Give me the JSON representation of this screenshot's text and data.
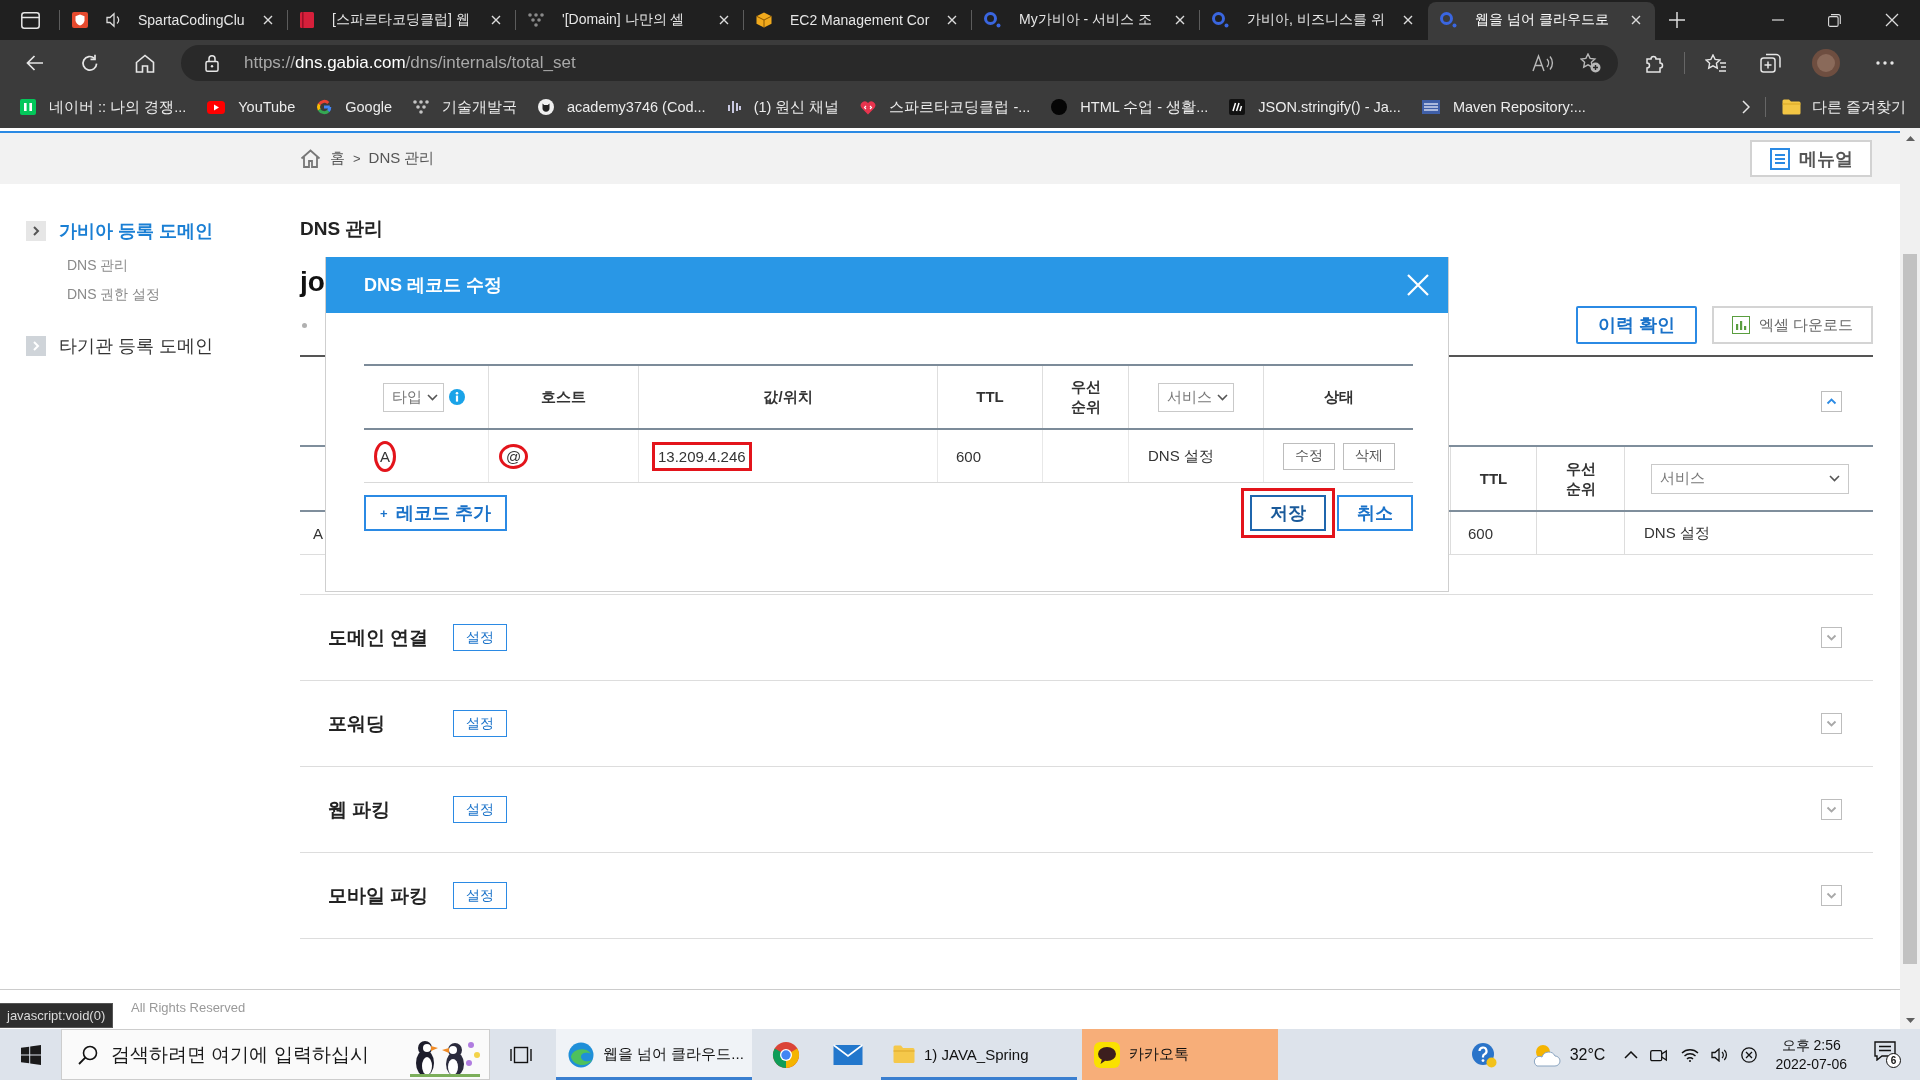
{
  "browser": {
    "tabs": [
      {
        "title": "SpartaCodingClu",
        "kind": "shield",
        "audio": true,
        "selected": false
      },
      {
        "title": "[스파르타코딩클럽] 웹",
        "kind": "book",
        "audio": false,
        "selected": false
      },
      {
        "title": "'[Domain] 나만의 셀",
        "kind": "dots",
        "audio": false,
        "selected": false
      },
      {
        "title": "EC2 Management Cor",
        "kind": "cube",
        "audio": false,
        "selected": false
      },
      {
        "title": "My가비아 - 서비스 조",
        "kind": "gabia",
        "audio": false,
        "selected": false
      },
      {
        "title": "가비아, 비즈니스를 위",
        "kind": "gabia",
        "audio": false,
        "selected": false
      },
      {
        "title": "웹을 넘어 클라우드로",
        "kind": "gabia",
        "audio": false,
        "selected": true
      }
    ],
    "address": {
      "scheme": "https://",
      "host": "dns.gabia.com",
      "path": "/dns/internals/total_set"
    },
    "bookmarks": [
      {
        "label": "네이버 :: 나의 경쟁...",
        "kind": "naver"
      },
      {
        "label": "YouTube",
        "kind": "youtube"
      },
      {
        "label": "Google",
        "kind": "google"
      },
      {
        "label": "기술개발국",
        "kind": "dots"
      },
      {
        "label": "academy3746 (Cod...",
        "kind": "github"
      },
      {
        "label": "(1) 원신 채널",
        "kind": "bars"
      },
      {
        "label": "스파르타코딩클럽 -...",
        "kind": "heart"
      },
      {
        "label": "HTML 수업 - 생활...",
        "kind": "circle"
      },
      {
        "label": "JSON.stringify() - Ja...",
        "kind": "m"
      },
      {
        "label": "Maven Repository:...",
        "kind": "maven"
      }
    ],
    "other_favorites": "다른 즐겨찾기"
  },
  "page": {
    "breadcrumb": {
      "home": "홈",
      "separator": ">",
      "current": "DNS 관리"
    },
    "manual_button": "메뉴얼",
    "sidebar": [
      {
        "label": "가비아 등록 도메인",
        "selected": true,
        "children": [
          {
            "label": "DNS 관리"
          },
          {
            "label": "DNS 권한 설정"
          }
        ]
      },
      {
        "label": "타기관 등록 도메인",
        "selected": false
      }
    ],
    "title": "DNS 관리",
    "domain": "jo",
    "history_button": "이력 확인",
    "excel_button": "엑셀 다운로드",
    "records_panel": {
      "expanded": true,
      "columns": [
        {
          "label": "TTL",
          "kind": "text"
        },
        {
          "label": "우선 순위",
          "kind": "text"
        },
        {
          "label": "서비스",
          "kind": "select"
        }
      ],
      "rows": [
        {
          "type": "A",
          "ttl": "600",
          "service": "DNS 설정"
        }
      ]
    },
    "sections": [
      {
        "title": "도메인 연결",
        "button": "설정",
        "expanded": false
      },
      {
        "title": "포워딩",
        "button": "설정",
        "expanded": false
      },
      {
        "title": "웹 파킹",
        "button": "설정",
        "expanded": false
      },
      {
        "title": "모바일 파킹",
        "button": "설정",
        "expanded": false
      }
    ],
    "footer": "All Rights Reserved",
    "status_link": "javascript:void(0)"
  },
  "modal": {
    "title": "DNS 레코드 수정",
    "columns": [
      {
        "label": "타입",
        "kind": "select",
        "help": true
      },
      {
        "label": "호스트",
        "kind": "text",
        "help": false
      },
      {
        "label": "값/위치",
        "kind": "text",
        "help": false
      },
      {
        "label": "TTL",
        "kind": "text",
        "help": false
      },
      {
        "label": "우선 순위",
        "kind": "text",
        "help": false
      },
      {
        "label": "서비스",
        "kind": "select",
        "help": false
      },
      {
        "label": "상태",
        "kind": "text",
        "help": false
      }
    ],
    "records": [
      {
        "type": "A",
        "type_marked": true,
        "host": "@",
        "host_marked": true,
        "value": "13.209.4.246",
        "value_marked": true,
        "ttl": "600",
        "service": "DNS 설정",
        "actions": [
          "수정",
          "삭제"
        ]
      }
    ],
    "add_button": {
      "prefix": "+",
      "label": "레코드 추가"
    },
    "save_button": {
      "label": "저장",
      "marked": true
    },
    "cancel_button": "취소"
  },
  "taskbar": {
    "search": {
      "placeholder": "검색하려면 여기에 입력하십시"
    },
    "apps": [
      {
        "kind": "edge",
        "label": "웹을 넘어 클라우드...",
        "running": true,
        "selected": true,
        "flashing": false
      },
      {
        "kind": "chrome",
        "running": false,
        "selected": false,
        "flashing": false
      },
      {
        "kind": "mail",
        "running": false,
        "selected": false,
        "flashing": false
      },
      {
        "kind": "folder",
        "label": "1) JAVA_Spring",
        "running": true,
        "selected": false,
        "flashing": false
      },
      {
        "kind": "kakao",
        "label": "카카오톡",
        "running": false,
        "selected": false,
        "flashing": true
      }
    ],
    "temperature": "32°C",
    "time": "오후 2:56",
    "date": "2022-07-06",
    "notifications": "6"
  }
}
